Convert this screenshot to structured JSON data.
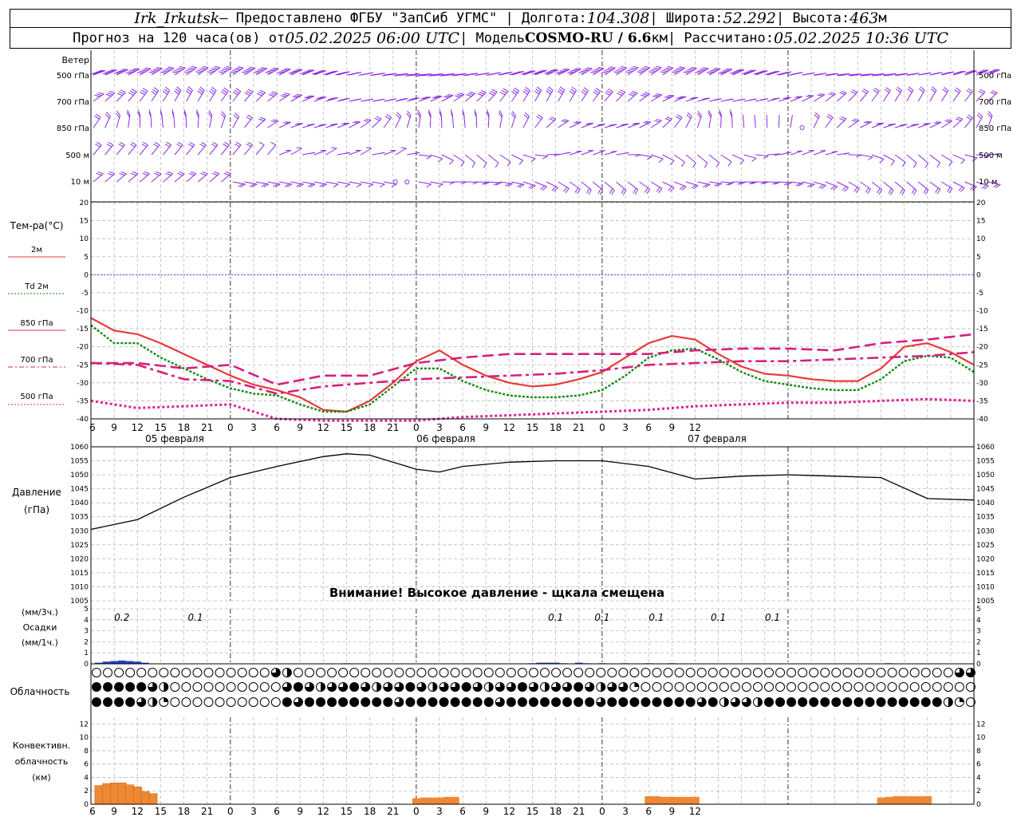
{
  "header": {
    "station": "Irk_Irkutsk",
    "provider": " — Предоставлено ФГБУ \"ЗапСиб УГМС\" | Долгота: ",
    "lon": "104.308",
    "lat_label": " | Широта: ",
    "lat": "52.292",
    "alt_label": " | Высота: ",
    "alt": "463",
    "alt_unit": "м",
    "forecast_label": "Прогноз на 120 часа(ов) от ",
    "forecast_from": "05.02.2025 06:00 UTC",
    "model_label": " | Модель ",
    "model": "COSMO-RU / 6.6",
    "model_unit": "км",
    "calc_label": " | Рассчитано: ",
    "calc_time": "05.02.2025 10:36 UTC"
  },
  "colors": {
    "wind": "#8a2be2",
    "t2m": "#e83a3a",
    "td2m": "#138a13",
    "t850": "#d6207e",
    "t700": "#d6207e",
    "t500": "#e0209a",
    "zero": "#3355dd",
    "pressure": "#000000",
    "precip": "#2040c0",
    "conv": "#ee8833"
  },
  "wind_panel": {
    "title": "Ветер",
    "levels": [
      "500 гПа",
      "700 гПа",
      "850 гПа",
      "500 м",
      "10  м"
    ]
  },
  "temp_panel": {
    "title": "Тем-ра(°C)",
    "legend": [
      "2м",
      "Td  2м",
      "850 гПа",
      "700 гПа",
      "500 гПа"
    ]
  },
  "pressure_panel": {
    "title1": "Давление",
    "title2": "(гПа)",
    "warning": "Внимание! Высокое давление - щкала смещена"
  },
  "precip_panel": {
    "title1": "(мм/3ч.)",
    "title2": "Осадки",
    "title3": "(мм/1ч.)",
    "labels": [
      "0.2",
      "0.1",
      "0.1",
      "0.1",
      "0.1",
      "0.1",
      "0.1"
    ]
  },
  "cloud_panel": {
    "title": "Облачность"
  },
  "conv_panel": {
    "title1": "Конвективн.",
    "title2": "облачность",
    "title3": "(км)"
  },
  "x_axis": {
    "hour_ticks": [
      "6",
      "9",
      "12",
      "15",
      "18",
      "21",
      "0",
      "3",
      "6",
      "9",
      "12",
      "15",
      "18",
      "21",
      "0",
      "3",
      "6",
      "9",
      "12",
      "15",
      "18",
      "21",
      "0",
      "3",
      "6",
      "9",
      "12"
    ],
    "dates": [
      "05 февраля",
      "06 февраля",
      "07 февраля"
    ]
  },
  "chart_data": [
    {
      "type": "line",
      "title": "Тем-ра(°C)",
      "x_unit": "hours from 05.02.2025 06:00 UTC",
      "ylim": [
        -40,
        20
      ],
      "y_ticks": [
        -40,
        -35,
        -30,
        -25,
        -20,
        -15,
        -10,
        -5,
        0,
        5,
        10,
        15,
        20
      ],
      "series": [
        {
          "name": "2м",
          "x": [
            0,
            3,
            6,
            9,
            12,
            15,
            18,
            21,
            24,
            27,
            30,
            33,
            36,
            39,
            42,
            45,
            48,
            51,
            54,
            57,
            60,
            63,
            66,
            69,
            72,
            75,
            78,
            81,
            84,
            87,
            90,
            93,
            96,
            99,
            102,
            105,
            108,
            111,
            114
          ],
          "values": [
            -12,
            -15.5,
            -16.5,
            -19,
            -22,
            -25,
            -28,
            -30.5,
            -32,
            -34,
            -37.5,
            -38,
            -35,
            -30,
            -24,
            -21,
            -25,
            -28,
            -30,
            -31,
            -30.5,
            -29,
            -27,
            -23,
            -19,
            -17,
            -18,
            -22,
            -25.5,
            -27.5,
            -28,
            -29,
            -29.5,
            -29.5,
            -26,
            -20,
            -19,
            -21.5,
            -25
          ]
        },
        {
          "name": "Td  2м",
          "x": [
            0,
            3,
            6,
            9,
            12,
            15,
            18,
            21,
            24,
            27,
            30,
            33,
            36,
            39,
            42,
            45,
            48,
            51,
            54,
            57,
            60,
            63,
            66,
            69,
            72,
            75,
            78,
            81,
            84,
            87,
            90,
            93,
            96,
            99,
            102,
            105,
            108,
            111,
            114
          ],
          "values": [
            -14,
            -19,
            -19,
            -23,
            -26,
            -29,
            -31.5,
            -33,
            -33.5,
            -36,
            -38,
            -38,
            -36,
            -31,
            -26,
            -26,
            -29.5,
            -32,
            -33.5,
            -34,
            -34,
            -33.5,
            -32,
            -28,
            -23,
            -21,
            -20.5,
            -23.5,
            -27,
            -29.5,
            -30.5,
            -31.5,
            -32,
            -32,
            -29,
            -24,
            -22.5,
            -23,
            -27
          ]
        },
        {
          "name": "850 гПа",
          "x": [
            0,
            6,
            12,
            18,
            24,
            30,
            36,
            42,
            48,
            54,
            60,
            66,
            72,
            78,
            84,
            90,
            96,
            102,
            108,
            114
          ],
          "values": [
            -24.5,
            -24.5,
            -26,
            -25,
            -30.5,
            -28,
            -28,
            -24.5,
            -23,
            -22,
            -22,
            -22,
            -22,
            -21,
            -20.5,
            -20.5,
            -21,
            -19,
            -18,
            -16.5
          ]
        },
        {
          "name": "700 гПа",
          "x": [
            0,
            6,
            12,
            18,
            24,
            30,
            36,
            42,
            48,
            54,
            60,
            66,
            72,
            78,
            84,
            90,
            96,
            102,
            108,
            114
          ],
          "values": [
            -24.5,
            -25,
            -29,
            -29.5,
            -33,
            -31,
            -30,
            -29,
            -28.5,
            -28,
            -27.5,
            -26.5,
            -25,
            -24.5,
            -24,
            -24,
            -23.5,
            -23,
            -22.5,
            -21.5
          ]
        },
        {
          "name": "500 гПа",
          "x": [
            0,
            6,
            12,
            18,
            24,
            30,
            36,
            42,
            48,
            54,
            60,
            66,
            72,
            78,
            84,
            90,
            96,
            102,
            108,
            114
          ],
          "values": [
            -35,
            -37,
            -36.5,
            -36,
            -40,
            -41,
            -42,
            -41,
            -39.5,
            -39,
            -38.5,
            -38,
            -37.5,
            -36.5,
            -36,
            -35.5,
            -35.5,
            -35,
            -34.5,
            -35
          ]
        }
      ]
    },
    {
      "type": "line",
      "title": "Давление",
      "ylabel": "(гПа)",
      "ylim": [
        1005,
        1060
      ],
      "y_ticks": [
        1005,
        1010,
        1015,
        1020,
        1025,
        1030,
        1035,
        1040,
        1045,
        1050,
        1055,
        1060
      ],
      "series": [
        {
          "x": [
            0,
            6,
            12,
            18,
            24,
            30,
            33,
            36,
            42,
            45,
            48,
            54,
            60,
            66,
            72,
            78,
            84,
            90,
            96,
            102,
            108,
            114
          ],
          "values": [
            1030.5,
            1034,
            1042,
            1049,
            1053,
            1056.5,
            1057.5,
            1057,
            1052,
            1051,
            1053,
            1054.5,
            1055,
            1055,
            1053,
            1048.5,
            1049.5,
            1050,
            1049.5,
            1049,
            1041.5,
            1041
          ]
        }
      ]
    },
    {
      "type": "bar",
      "title": "Осадки",
      "ylabel": "(мм/3ч.) (мм/1ч.)",
      "ylim": [
        0,
        5
      ],
      "y_ticks": [
        0,
        1,
        2,
        3,
        4,
        5
      ],
      "series": [
        {
          "x": [
            1,
            2,
            3,
            4,
            5,
            6,
            7,
            33,
            57,
            58,
            59,
            60,
            61,
            63,
            64,
            66,
            69,
            72,
            75,
            103
          ],
          "values": [
            0.1,
            0.2,
            0.25,
            0.3,
            0.25,
            0.2,
            0.1,
            0.05,
            0.05,
            0.1,
            0.1,
            0.1,
            0.05,
            0.1,
            0.05,
            0.05,
            0.05,
            0.05,
            0.05,
            0.05
          ]
        }
      ]
    },
    {
      "type": "bar",
      "title": "Конвективн. облачность",
      "ylabel": "(км)",
      "ylim": [
        0,
        13
      ],
      "y_ticks": [
        0,
        2,
        4,
        6,
        8,
        10,
        12
      ],
      "series": [
        {
          "x": [
            1,
            2,
            3,
            4,
            5,
            6,
            7,
            8
          ],
          "values": [
            2.8,
            3.1,
            3.2,
            3.2,
            2.9,
            2.6,
            1.9,
            1.6
          ]
        },
        {
          "x": [
            42,
            43,
            44,
            45,
            46,
            47
          ],
          "values": [
            0.9,
            1.0,
            1.0,
            1.0,
            1.1,
            1.1
          ]
        },
        {
          "x": [
            72,
            73,
            74,
            75,
            76,
            77,
            78
          ],
          "values": [
            1.2,
            1.2,
            1.1,
            1.1,
            1.1,
            1.1,
            1.1
          ]
        },
        {
          "x": [
            102,
            103,
            104,
            105,
            106,
            107,
            108
          ],
          "values": [
            1.0,
            1.1,
            1.2,
            1.2,
            1.2,
            1.2,
            1.2
          ]
        }
      ]
    }
  ]
}
